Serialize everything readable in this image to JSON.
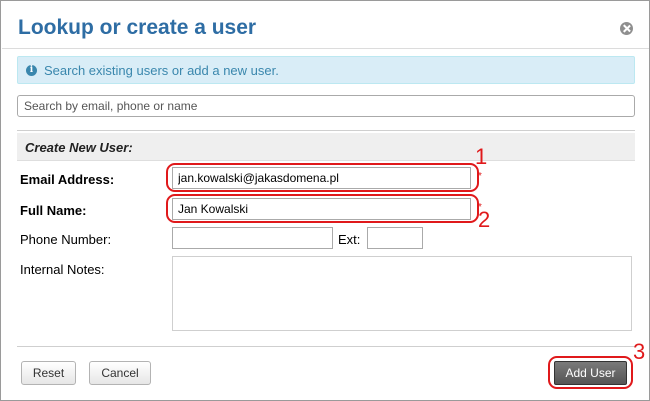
{
  "dialog": {
    "title": "Lookup or create a user",
    "close_icon": "close-icon"
  },
  "info": {
    "icon": "info-icon",
    "icon_glyph": "i",
    "text": "Search existing users or add a new user."
  },
  "search": {
    "placeholder": "Search by email, phone or name",
    "value": ""
  },
  "section": {
    "title": "Create New User:"
  },
  "form": {
    "email": {
      "label": "Email Address:",
      "value": "jan.kowalski@jakasdomena.pl",
      "required": "*"
    },
    "full_name": {
      "label": "Full Name:",
      "value": "Jan Kowalski",
      "required": "*"
    },
    "phone": {
      "label": "Phone Number:",
      "value": "",
      "ext_label": "Ext:",
      "ext_value": ""
    },
    "notes": {
      "label": "Internal Notes:",
      "value": ""
    }
  },
  "annotations": [
    "1",
    "2",
    "3"
  ],
  "buttons": {
    "reset": "Reset",
    "cancel": "Cancel",
    "add_user": "Add User"
  },
  "colors": {
    "title": "#2e6da4",
    "info_bg": "#d9edf7",
    "info_text": "#3a87ad",
    "annotation": "#e0191b",
    "primary_button": "#555555"
  }
}
